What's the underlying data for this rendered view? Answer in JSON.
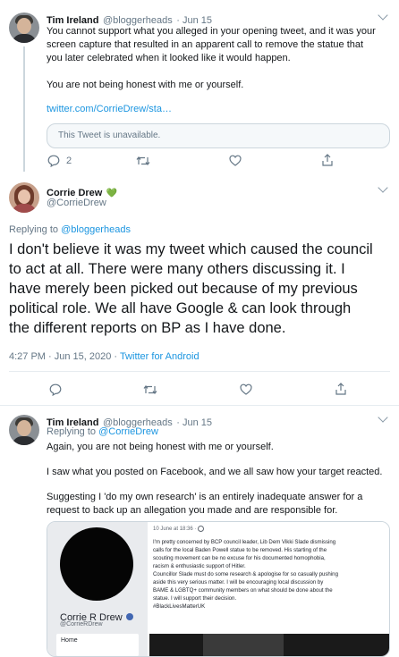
{
  "tweet1": {
    "name": "Tim Ireland",
    "handle": "@bloggerheads",
    "date": "· Jun 15",
    "body_lines": [
      "You cannot support what you alleged in your opening tweet, and it was your",
      "screen capture that resulted in an apparent call to remove the statue that",
      "you later celebrated when it looked like it would happen."
    ],
    "body2": "You are not being honest with me or yourself.",
    "link": "twitter.com/CorrieDrew/sta…",
    "quote_unavailable": "This Tweet is unavailable.",
    "reply_count": "2"
  },
  "tweet2": {
    "name": "Corrie Drew",
    "heart": "💚",
    "handle": "@CorrieDrew",
    "replying_prefix": "Replying to",
    "replying_to": "@bloggerheads",
    "body_lines": [
      "I don't believe it was my tweet which caused the council",
      "to act at all. There were many others discussing it. I",
      "have merely been picked out because of my previous",
      "political role. We all have Google & can look through",
      "the different reports on BP as I have done."
    ],
    "timestamp": "4:27 PM · Jun 15, 2020 · ",
    "source": "Twitter for Android"
  },
  "tweet3": {
    "name": "Tim Ireland",
    "handle": "@bloggerheads",
    "date": "· Jun 15",
    "replying_prefix": "Replying to",
    "replying_to": "@CorrieDrew",
    "line1": "Again, you are not being honest with me or yourself.",
    "line2": "I saw what you posted on Facebook, and we all saw how your target reacted.",
    "line3a": "Suggesting I 'do my own research' is an entirely inadequate answer for a",
    "line3b": "request to back up an allegation you made and are responsible for.",
    "image": {
      "fb_name": "Corrie R Drew",
      "fb_handle": "@CorrieRDrew",
      "fb_nav": "Home",
      "post_date": "10 June at 18:36 · ",
      "post_lines": [
        "I'm pretty concerned by BCP council leader, Lib Dem Vikki Slade dismissing",
        "calls for the local Baden Powell statue to be removed. His starting of the",
        "scouting movement can be no excuse for his documented homophobia,",
        "racism & enthusiastic support of Hitler.",
        "Councillor Slade must do some research & apologise for so casually pushing",
        "aside this very serious matter. I will be encouraging local discussion by",
        "BAME & LGBTQ+ community members on what should be done about the",
        "statue. I will support their decision.",
        "#BlackLivesMatterUK"
      ]
    }
  },
  "colors": {
    "accent": "#1b95e0",
    "muted": "#657786",
    "heart": "#4caf50"
  }
}
